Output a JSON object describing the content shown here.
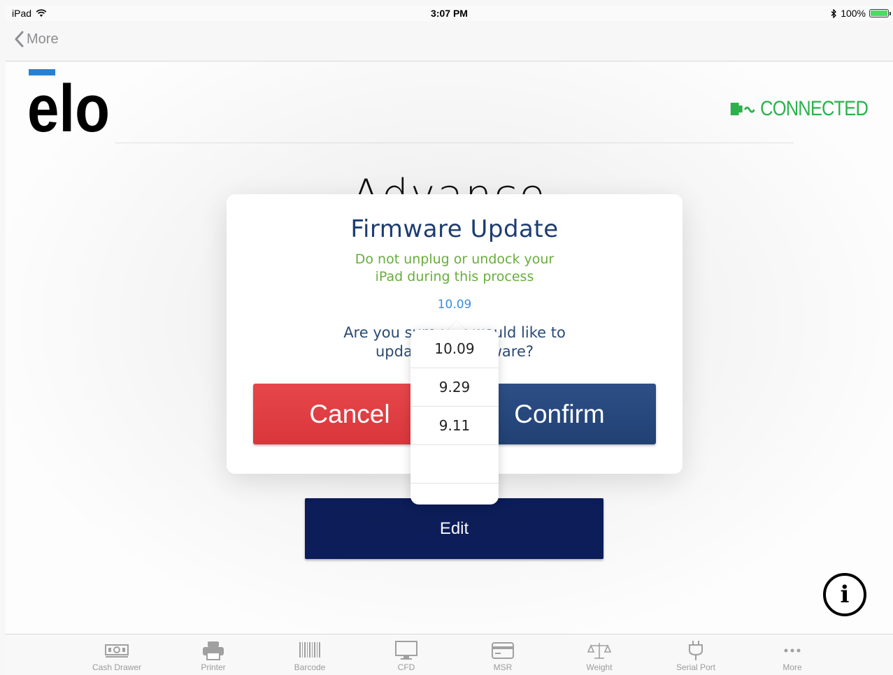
{
  "status_bar": {
    "device": "iPad",
    "time": "3:07 PM",
    "battery": "100%"
  },
  "nav": {
    "back_label": "More"
  },
  "header": {
    "connection_status": "CONNECTED"
  },
  "page": {
    "title": "Advance",
    "edit_label": "Edit"
  },
  "dialog": {
    "title": "Firmware Update",
    "warning_line1": "Do not unplug or undock your",
    "warning_line2": "iPad during this process",
    "selected_version": "10.09",
    "question_line1": "Are you sure you would like to",
    "question_line2": "update the firmware?",
    "cancel_label": "Cancel",
    "confirm_label": "Confirm"
  },
  "version_picker": {
    "options": [
      "10.09",
      "9.29",
      "9.11",
      "",
      ""
    ]
  },
  "tab_bar": {
    "tabs": [
      {
        "label": "Cash Drawer",
        "icon": "cash-drawer-icon"
      },
      {
        "label": "Printer",
        "icon": "printer-icon"
      },
      {
        "label": "Barcode",
        "icon": "barcode-icon"
      },
      {
        "label": "CFD",
        "icon": "monitor-icon"
      },
      {
        "label": "MSR",
        "icon": "card-icon"
      },
      {
        "label": "Weight",
        "icon": "scale-icon"
      },
      {
        "label": "Serial Port",
        "icon": "plug-icon"
      },
      {
        "label": "More",
        "icon": "more-icon"
      }
    ]
  },
  "colors": {
    "connected": "#2bb24c",
    "dialog_title": "#1d3d72",
    "warning": "#67ae3a",
    "version": "#3b8de0",
    "cancel": "#e0393e",
    "confirm": "#284a7f",
    "edit": "#0c1e5b",
    "logo_bar": "#2a7fd1"
  }
}
